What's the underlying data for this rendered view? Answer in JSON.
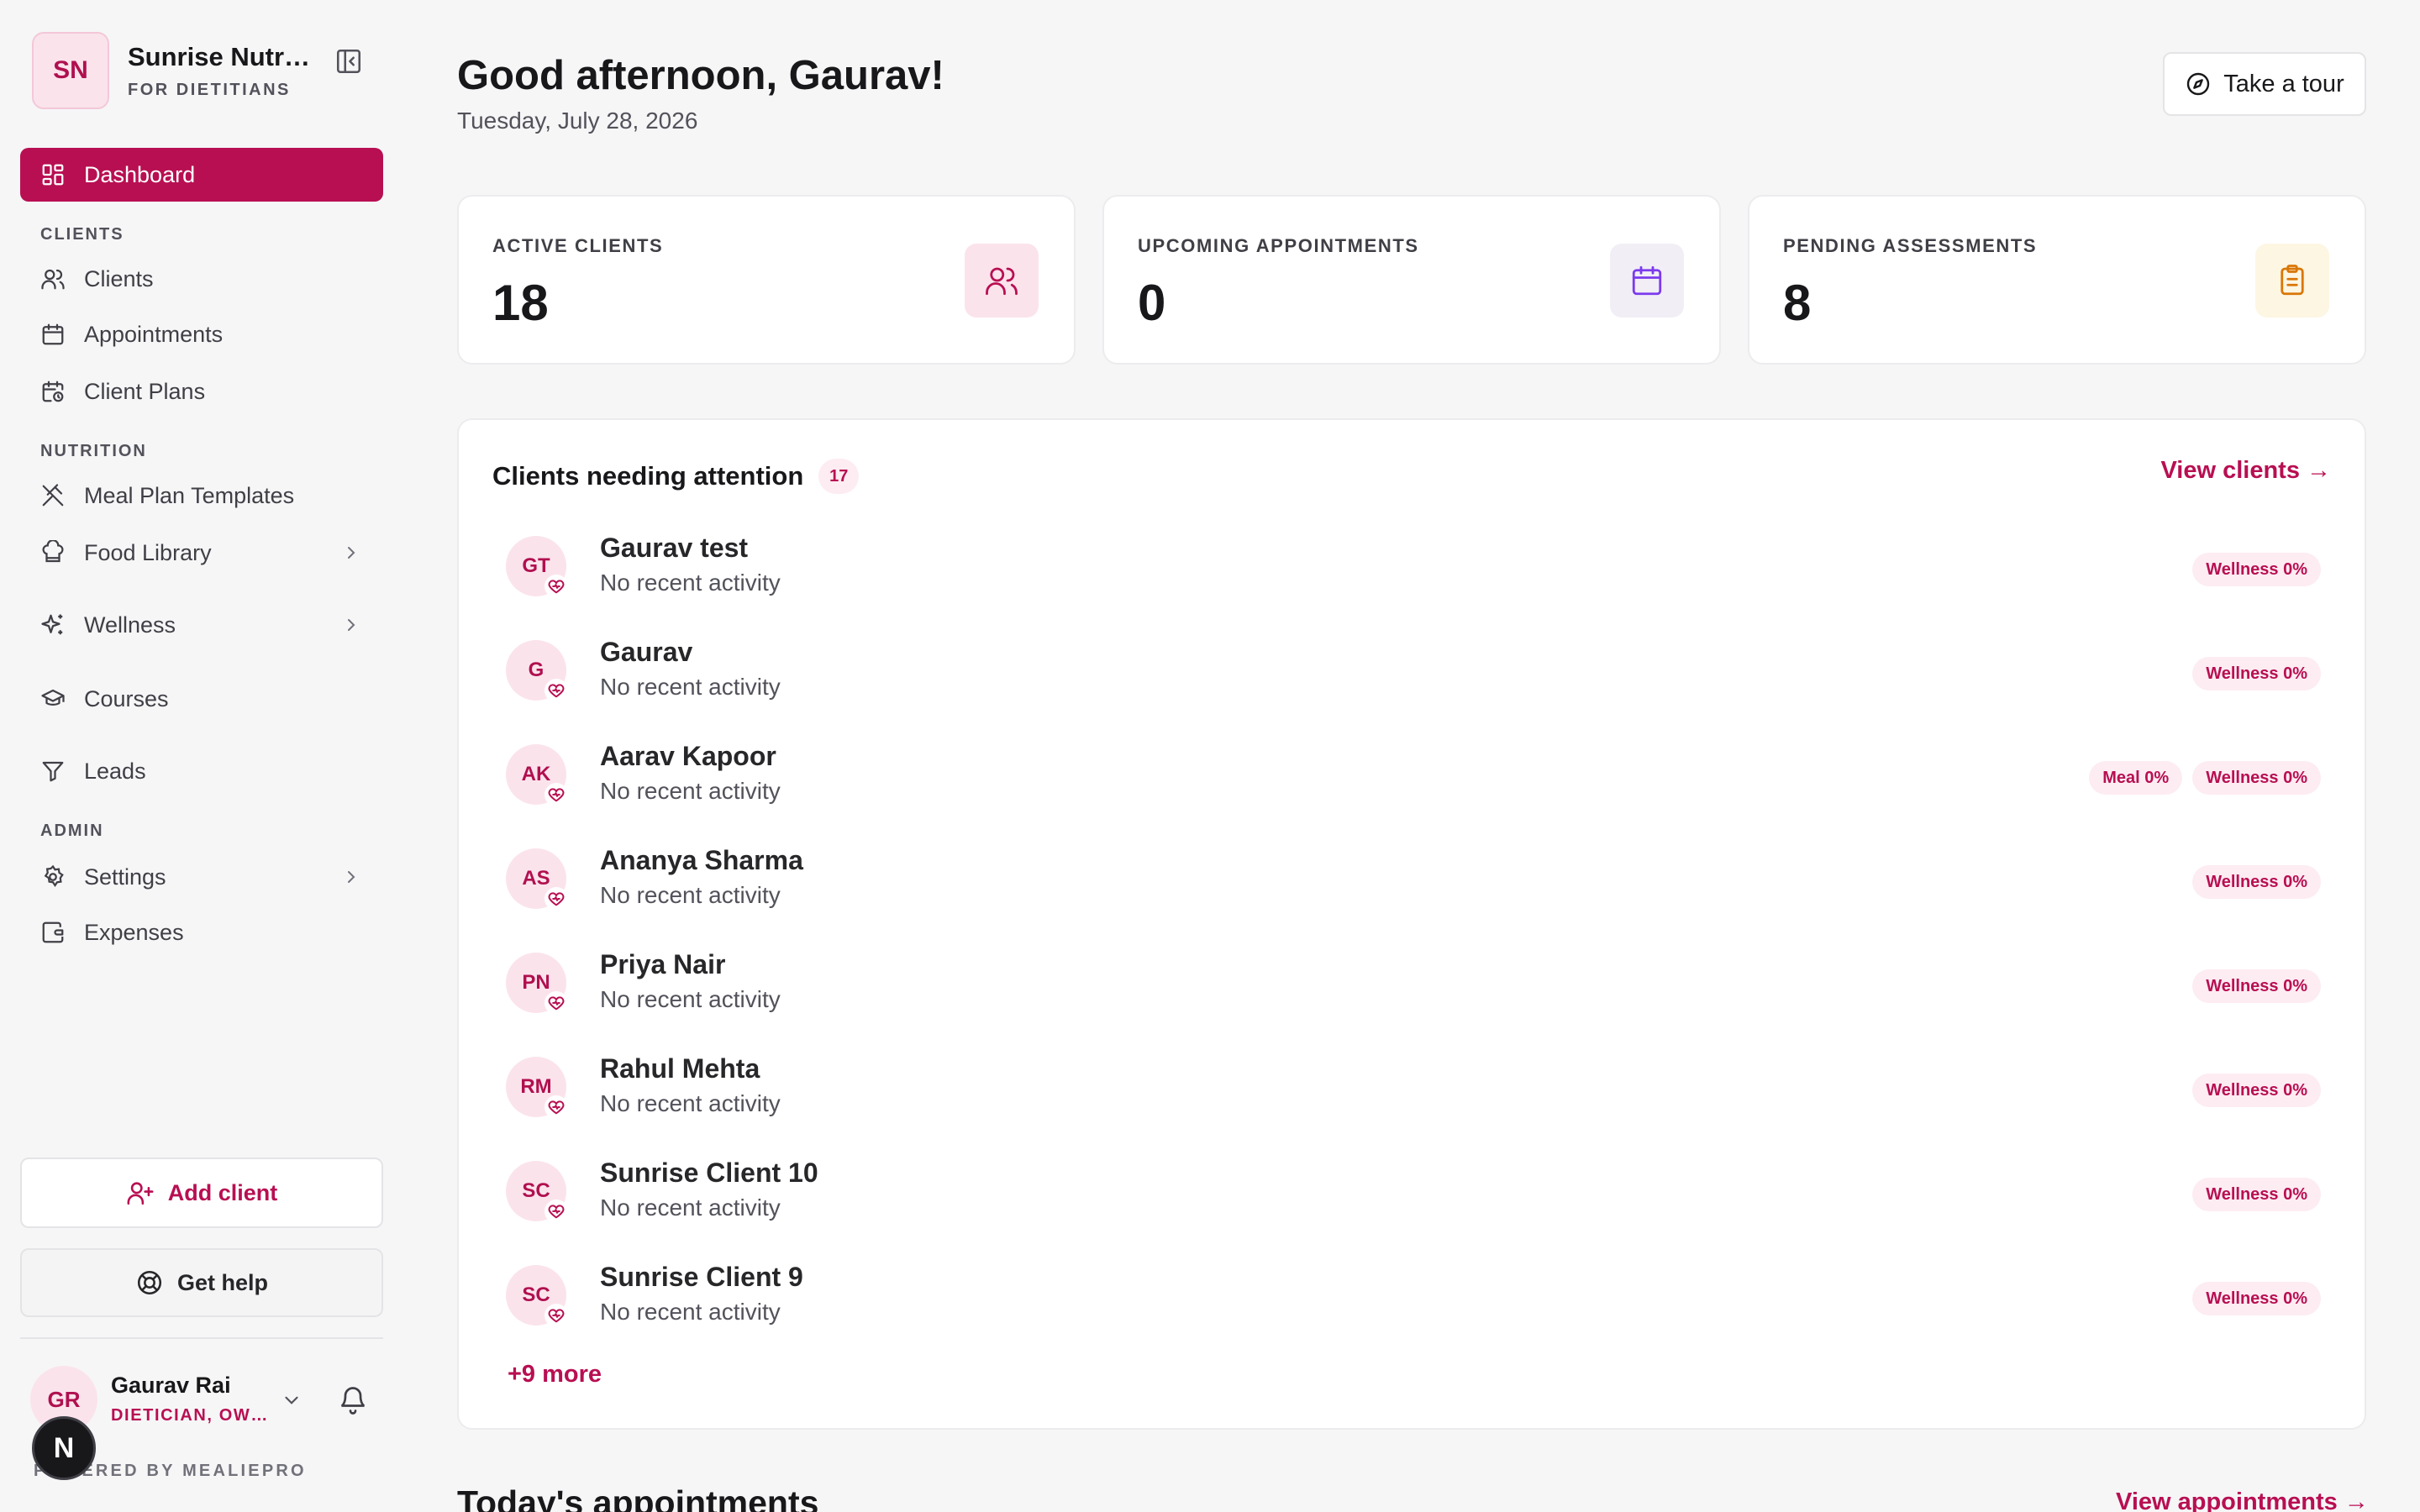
{
  "brand": {
    "initials": "SN",
    "name": "Sunrise Nutr…",
    "subtitle": "FOR DIETITIANS"
  },
  "sidebar": {
    "dashboard": "Dashboard",
    "sections": {
      "clients": "CLIENTS",
      "nutrition": "NUTRITION",
      "admin": "ADMIN"
    },
    "items": {
      "clients": "Clients",
      "appointments": "Appointments",
      "client_plans": "Client Plans",
      "meal_plan_templates": "Meal Plan Templates",
      "food_library": "Food Library",
      "wellness": "Wellness",
      "courses": "Courses",
      "leads": "Leads",
      "settings": "Settings",
      "expenses": "Expenses"
    },
    "add_client": "Add client",
    "get_help": "Get help",
    "user": {
      "initials": "GR",
      "name": "Gaurav Rai",
      "role": "DIETICIAN, OW…"
    },
    "powered_by": "POWERED BY MEALIEPRO",
    "floating_badge": "N"
  },
  "header": {
    "greeting": "Good afternoon, Gaurav!",
    "date": "Tuesday, July 28, 2026",
    "tour_button": "Take a tour"
  },
  "stats": [
    {
      "label": "ACTIVE CLIENTS",
      "value": "18",
      "icon": "users-icon",
      "color": "#b80f52"
    },
    {
      "label": "UPCOMING APPOINTMENTS",
      "value": "0",
      "icon": "calendar-icon",
      "color": "#7c3aed"
    },
    {
      "label": "PENDING ASSESSMENTS",
      "value": "8",
      "icon": "clipboard-icon",
      "color": "#d97706"
    }
  ],
  "attention": {
    "title": "Clients needing attention",
    "count": "17",
    "view_link": "View clients →",
    "more": "+9 more",
    "clients": [
      {
        "initials": "GT",
        "name": "Gaurav test",
        "status": "No recent activity",
        "tags": [
          "Wellness 0%"
        ]
      },
      {
        "initials": "G",
        "name": "Gaurav",
        "status": "No recent activity",
        "tags": [
          "Wellness 0%"
        ]
      },
      {
        "initials": "AK",
        "name": "Aarav Kapoor",
        "status": "No recent activity",
        "tags": [
          "Meal 0%",
          "Wellness 0%"
        ]
      },
      {
        "initials": "AS",
        "name": "Ananya Sharma",
        "status": "No recent activity",
        "tags": [
          "Wellness 0%"
        ]
      },
      {
        "initials": "PN",
        "name": "Priya Nair",
        "status": "No recent activity",
        "tags": [
          "Wellness 0%"
        ]
      },
      {
        "initials": "RM",
        "name": "Rahul Mehta",
        "status": "No recent activity",
        "tags": [
          "Wellness 0%"
        ]
      },
      {
        "initials": "SC",
        "name": "Sunrise Client 10",
        "status": "No recent activity",
        "tags": [
          "Wellness 0%"
        ]
      },
      {
        "initials": "SC",
        "name": "Sunrise Client 9",
        "status": "No recent activity",
        "tags": [
          "Wellness 0%"
        ]
      }
    ]
  },
  "today": {
    "title": "Today's appointments",
    "view_link": "View appointments →"
  },
  "colors": {
    "accent": "#b80f52",
    "accent_soft": "#fbe3ec",
    "background": "#f6f6f7"
  }
}
